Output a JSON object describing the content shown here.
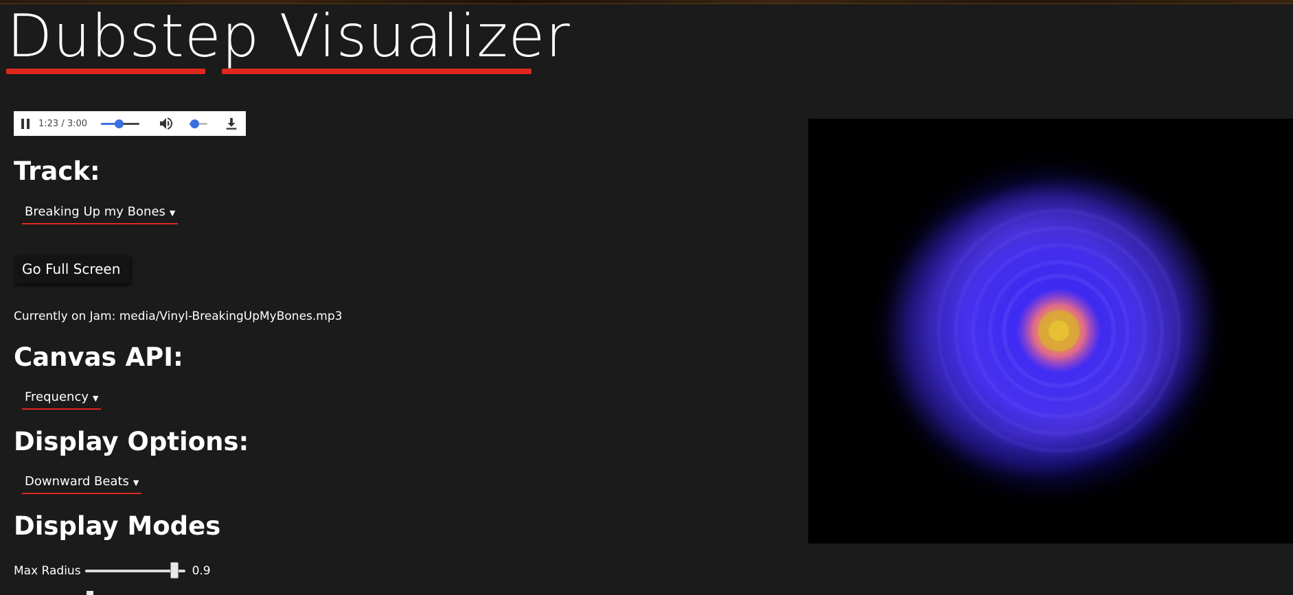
{
  "app": {
    "title": "Dubstep Visualizer"
  },
  "player": {
    "time": "1:23 / 3:00",
    "progress": 0.46,
    "volume": 0.25
  },
  "track": {
    "heading": "Track:",
    "selected": "Breaking Up my Bones"
  },
  "fullscreen_button": "Go Full Screen",
  "now_playing": "Currently on Jam: media/Vinyl-BreakingUpMyBones.mp3",
  "canvas_api": {
    "heading": "Canvas API:",
    "selected": "Frequency"
  },
  "display_options": {
    "heading": "Display Options:",
    "selected": "Downward Beats"
  },
  "display_modes": {
    "heading": "Display Modes",
    "max_radius_label": "Max Radius",
    "max_radius_value": "0.9",
    "max_radius_fraction": 0.9
  },
  "colors": {
    "accent": "#e0281e",
    "background": "#1b1b1b",
    "slider_blue": "#3b6fe0",
    "glow_blue": "#2a1aff",
    "core_pink": "#e06a8a",
    "core_yellow": "#e6c030"
  },
  "icons": {
    "pause": "pause-icon",
    "volume": "volume-icon",
    "download": "download-icon"
  }
}
